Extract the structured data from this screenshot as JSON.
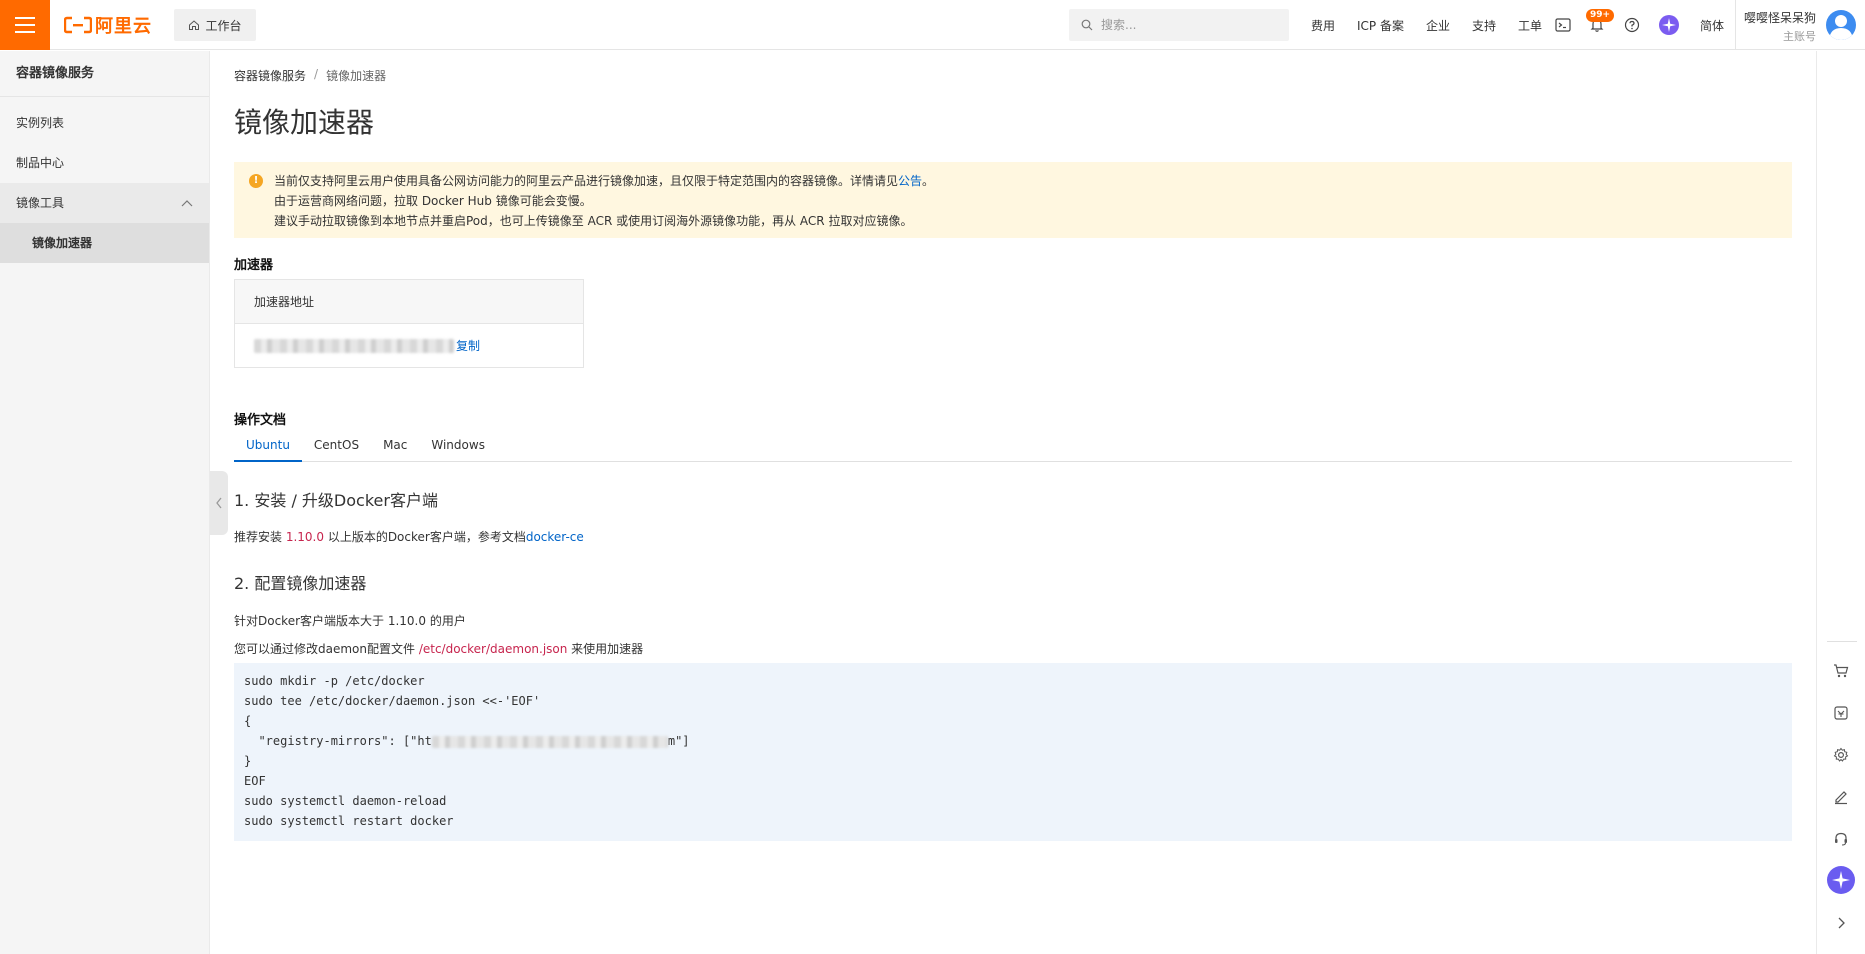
{
  "topbar": {
    "logo_text": "阿里云",
    "workbench_label": "工作台",
    "search_placeholder": "搜索...",
    "nav": [
      "费用",
      "ICP 备案",
      "企业",
      "支持",
      "工单"
    ],
    "notification_badge": "99+",
    "language": "简体",
    "user_name": "嘤嘤怪呆呆狗",
    "user_role": "主账号",
    "brand_color": "#ff6a00"
  },
  "sidebar": {
    "title": "容器镜像服务",
    "items": [
      {
        "label": "实例列表"
      },
      {
        "label": "制品中心"
      },
      {
        "label": "镜像工具"
      },
      {
        "label": "镜像加速器"
      }
    ]
  },
  "breadcrumb": {
    "root": "容器镜像服务",
    "separator": "/",
    "current": "镜像加速器"
  },
  "page_title": "镜像加速器",
  "notice": {
    "line1_text": "当前仅支持阿里云用户使用具备公网访问能力的阿里云产品进行镜像加速，且仅限于特定范围内的容器镜像。详情请见",
    "line1_link": "公告",
    "line1_end": "。",
    "line2": "由于运营商网络问题，拉取 Docker Hub 镜像可能会变慢。",
    "line3": "建议手动拉取镜像到本地节点并重启Pod，也可上传镜像至 ACR 或使用订阅海外源镜像功能，再从 ACR 拉取对应镜像。"
  },
  "accelerator": {
    "section_title": "加速器",
    "column_header": "加速器地址",
    "copy_label": "复制"
  },
  "docs": {
    "section_title": "操作文档",
    "tabs": [
      "Ubuntu",
      "CentOS",
      "Mac",
      "Windows"
    ],
    "active_tab": "Ubuntu",
    "step1_title": "1. 安装 / 升级Docker客户端",
    "step1_pre": "推荐安装 ",
    "step1_version": "1.10.0",
    "step1_mid": " 以上版本的Docker客户端，参考文档",
    "step1_link": "docker-ce",
    "step2_title": "2. 配置镜像加速器",
    "step2_p1": "针对Docker客户端版本大于 1.10.0 的用户",
    "step2_p2_pre": "您可以通过修改daemon配置文件 ",
    "step2_p2_path": "/etc/docker/daemon.json",
    "step2_p2_post": " 来使用加速器",
    "code": {
      "l1": "sudo mkdir -p /etc/docker",
      "l2": "sudo tee /etc/docker/daemon.json <<-'EOF'",
      "l3": "{",
      "l4_pre": "  \"registry-mirrors\": [\"ht",
      "l4_post": "m\"]",
      "l5": "}",
      "l6": "EOF",
      "l7": "sudo systemctl daemon-reload",
      "l8": "sudo systemctl restart docker"
    }
  }
}
